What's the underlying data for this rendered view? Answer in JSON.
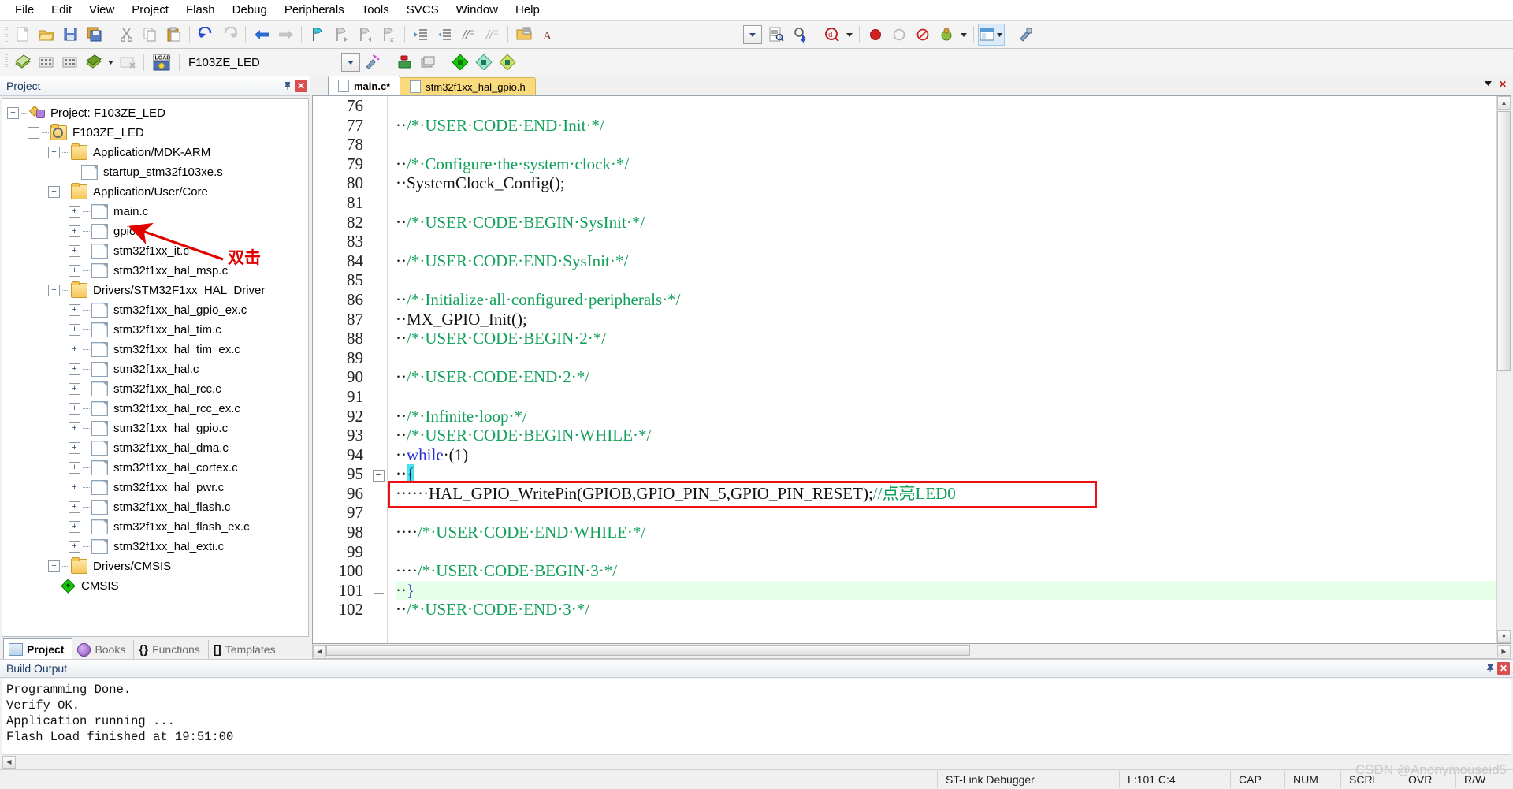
{
  "menu": {
    "items": [
      "File",
      "Edit",
      "View",
      "Project",
      "Flash",
      "Debug",
      "Peripherals",
      "Tools",
      "SVCS",
      "Window",
      "Help"
    ]
  },
  "toolbar1": {
    "icons": [
      "new-file-icon",
      "open-folder-icon",
      "save-icon",
      "save-all-icon",
      "cut-icon",
      "copy-icon",
      "paste-icon",
      "undo-icon",
      "redo-icon",
      "navigate-back-icon",
      "navigate-forward-icon",
      "bookmark-toggle-icon",
      "bookmark-prev-icon",
      "bookmark-next-icon",
      "bookmark-clear-icon",
      "indent-icon",
      "outdent-icon",
      "comment-icon",
      "uncomment-icon",
      "open-in-window-icon",
      "font-icon",
      "find-combo-icon",
      "find-in-files-icon",
      "incremental-find-icon",
      "search-icon",
      "record-icon",
      "stop-icon",
      "break-icon",
      "debug-icon",
      "window-layout-icon",
      "configure-icon"
    ]
  },
  "toolbar2": {
    "project_name": "F103ZE_LED",
    "icons": [
      "translate-icon",
      "build-icon",
      "rebuild-icon",
      "batch-build-icon",
      "stop-build-icon",
      "load-icon",
      "target-combo-icon",
      "target-options-icon",
      "manage-runtime-icon",
      "multiproject-icon",
      "pack-installer-icon",
      "pack-installer2-icon",
      "pack-installer3-icon"
    ],
    "load_label": "LOAD"
  },
  "project_pane": {
    "header_title": "Project",
    "pin_icon": "pin-icon",
    "close_icon": "close-icon",
    "tree": [
      {
        "label": "Project: F103ZE_LED",
        "depth": 0,
        "expander": "minus",
        "icon": "project-icon"
      },
      {
        "label": "F103ZE_LED",
        "depth": 1,
        "expander": "minus",
        "icon": "target-icon"
      },
      {
        "label": "Application/MDK-ARM",
        "depth": 2,
        "expander": "minus",
        "icon": "folder-icon"
      },
      {
        "label": "startup_stm32f103xe.s",
        "depth": 3,
        "expander": "none",
        "icon": "file-icon"
      },
      {
        "label": "Application/User/Core",
        "depth": 2,
        "expander": "minus",
        "icon": "folder-icon"
      },
      {
        "label": "main.c",
        "depth": 3,
        "expander": "plus",
        "icon": "file-icon"
      },
      {
        "label": "gpio.c",
        "depth": 3,
        "expander": "plus",
        "icon": "file-icon"
      },
      {
        "label": "stm32f1xx_it.c",
        "depth": 3,
        "expander": "plus",
        "icon": "file-icon"
      },
      {
        "label": "stm32f1xx_hal_msp.c",
        "depth": 3,
        "expander": "plus",
        "icon": "file-icon"
      },
      {
        "label": "Drivers/STM32F1xx_HAL_Driver",
        "depth": 2,
        "expander": "minus",
        "icon": "folder-icon"
      },
      {
        "label": "stm32f1xx_hal_gpio_ex.c",
        "depth": 3,
        "expander": "plus",
        "icon": "file-icon"
      },
      {
        "label": "stm32f1xx_hal_tim.c",
        "depth": 3,
        "expander": "plus",
        "icon": "file-icon"
      },
      {
        "label": "stm32f1xx_hal_tim_ex.c",
        "depth": 3,
        "expander": "plus",
        "icon": "file-icon"
      },
      {
        "label": "stm32f1xx_hal.c",
        "depth": 3,
        "expander": "plus",
        "icon": "file-icon"
      },
      {
        "label": "stm32f1xx_hal_rcc.c",
        "depth": 3,
        "expander": "plus",
        "icon": "file-icon"
      },
      {
        "label": "stm32f1xx_hal_rcc_ex.c",
        "depth": 3,
        "expander": "plus",
        "icon": "file-icon"
      },
      {
        "label": "stm32f1xx_hal_gpio.c",
        "depth": 3,
        "expander": "plus",
        "icon": "file-icon"
      },
      {
        "label": "stm32f1xx_hal_dma.c",
        "depth": 3,
        "expander": "plus",
        "icon": "file-icon"
      },
      {
        "label": "stm32f1xx_hal_cortex.c",
        "depth": 3,
        "expander": "plus",
        "icon": "file-icon"
      },
      {
        "label": "stm32f1xx_hal_pwr.c",
        "depth": 3,
        "expander": "plus",
        "icon": "file-icon"
      },
      {
        "label": "stm32f1xx_hal_flash.c",
        "depth": 3,
        "expander": "plus",
        "icon": "file-icon"
      },
      {
        "label": "stm32f1xx_hal_flash_ex.c",
        "depth": 3,
        "expander": "plus",
        "icon": "file-icon"
      },
      {
        "label": "stm32f1xx_hal_exti.c",
        "depth": 3,
        "expander": "plus",
        "icon": "file-icon"
      },
      {
        "label": "Drivers/CMSIS",
        "depth": 2,
        "expander": "plus",
        "icon": "folder-icon"
      },
      {
        "label": "CMSIS",
        "depth": 2,
        "expander": "none",
        "icon": "cmsis-icon"
      }
    ],
    "annotation": {
      "text": "双击",
      "color": "#e00000",
      "arrow_icon": "red-arrow-icon"
    },
    "tabs": [
      {
        "label": "Project",
        "icon": "project-tab-icon",
        "active": true
      },
      {
        "label": "Books",
        "icon": "books-icon",
        "active": false
      },
      {
        "label": "Functions",
        "icon": "functions-icon",
        "active": false
      },
      {
        "label": "Templates",
        "icon": "templates-icon",
        "active": false
      }
    ]
  },
  "editor": {
    "tabs": [
      {
        "label": "main.c*",
        "active": true
      },
      {
        "label": "stm32f1xx_hal_gpio.h",
        "active": false
      }
    ],
    "window_buttons": [
      "minimize-icon",
      "close-icon"
    ],
    "first_line_number": 76,
    "lines": [
      {
        "n": 76,
        "segments": [],
        "fold": "",
        "highlight": false
      },
      {
        "n": 77,
        "segments": [
          {
            "t": "··",
            "c": "plain"
          },
          {
            "t": "/*·USER·CODE·END·Init·*/",
            "c": "comment"
          }
        ],
        "fold": "",
        "highlight": false
      },
      {
        "n": 78,
        "segments": [],
        "fold": "",
        "highlight": false
      },
      {
        "n": 79,
        "segments": [
          {
            "t": "··",
            "c": "plain"
          },
          {
            "t": "/*·Configure·the·system·clock·*/",
            "c": "comment"
          }
        ],
        "fold": "",
        "highlight": false
      },
      {
        "n": 80,
        "segments": [
          {
            "t": "··SystemClock_Config();",
            "c": "plain"
          }
        ],
        "fold": "",
        "highlight": false
      },
      {
        "n": 81,
        "segments": [],
        "fold": "",
        "highlight": false
      },
      {
        "n": 82,
        "segments": [
          {
            "t": "··",
            "c": "plain"
          },
          {
            "t": "/*·USER·CODE·BEGIN·SysInit·*/",
            "c": "comment"
          }
        ],
        "fold": "",
        "highlight": false
      },
      {
        "n": 83,
        "segments": [],
        "fold": "",
        "highlight": false
      },
      {
        "n": 84,
        "segments": [
          {
            "t": "··",
            "c": "plain"
          },
          {
            "t": "/*·USER·CODE·END·SysInit·*/",
            "c": "comment"
          }
        ],
        "fold": "",
        "highlight": false
      },
      {
        "n": 85,
        "segments": [],
        "fold": "",
        "highlight": false
      },
      {
        "n": 86,
        "segments": [
          {
            "t": "··",
            "c": "plain"
          },
          {
            "t": "/*·Initialize·all·configured·peripherals·*/",
            "c": "comment"
          }
        ],
        "fold": "",
        "highlight": false
      },
      {
        "n": 87,
        "segments": [
          {
            "t": "··MX_GPIO_Init();",
            "c": "plain"
          }
        ],
        "fold": "",
        "highlight": false
      },
      {
        "n": 88,
        "segments": [
          {
            "t": "··",
            "c": "plain"
          },
          {
            "t": "/*·USER·CODE·BEGIN·2·*/",
            "c": "comment"
          }
        ],
        "fold": "",
        "highlight": false
      },
      {
        "n": 89,
        "segments": [],
        "fold": "",
        "highlight": false
      },
      {
        "n": 90,
        "segments": [
          {
            "t": "··",
            "c": "plain"
          },
          {
            "t": "/*·USER·CODE·END·2·*/",
            "c": "comment"
          }
        ],
        "fold": "",
        "highlight": false
      },
      {
        "n": 91,
        "segments": [],
        "fold": "",
        "highlight": false
      },
      {
        "n": 92,
        "segments": [
          {
            "t": "··",
            "c": "plain"
          },
          {
            "t": "/*·Infinite·loop·*/",
            "c": "comment"
          }
        ],
        "fold": "",
        "highlight": false
      },
      {
        "n": 93,
        "segments": [
          {
            "t": "··",
            "c": "plain"
          },
          {
            "t": "/*·USER·CODE·BEGIN·WHILE·*/",
            "c": "comment"
          }
        ],
        "fold": "",
        "highlight": false
      },
      {
        "n": 94,
        "segments": [
          {
            "t": "··",
            "c": "plain"
          },
          {
            "t": "while",
            "c": "keyword"
          },
          {
            "t": "·(1)",
            "c": "plain"
          }
        ],
        "fold": "",
        "highlight": false
      },
      {
        "n": 95,
        "segments": [
          {
            "t": "··",
            "c": "plain"
          },
          {
            "t": "{",
            "c": "brace-match"
          }
        ],
        "fold": "minus",
        "highlight": false
      },
      {
        "n": 96,
        "segments": [
          {
            "t": "······HAL_GPIO_WritePin(GPIOB,GPIO_PIN_5,GPIO_PIN_RESET);",
            "c": "plain"
          },
          {
            "t": "//点亮LED0",
            "c": "comment"
          }
        ],
        "fold": "",
        "highlight": false
      },
      {
        "n": 97,
        "segments": [],
        "fold": "",
        "highlight": false
      },
      {
        "n": 98,
        "segments": [
          {
            "t": "····",
            "c": "plain"
          },
          {
            "t": "/*·USER·CODE·END·WHILE·*/",
            "c": "comment"
          }
        ],
        "fold": "",
        "highlight": false
      },
      {
        "n": 99,
        "segments": [],
        "fold": "",
        "highlight": false
      },
      {
        "n": 100,
        "segments": [
          {
            "t": "····",
            "c": "plain"
          },
          {
            "t": "/*·USER·CODE·BEGIN·3·*/",
            "c": "comment"
          }
        ],
        "fold": "",
        "highlight": false
      },
      {
        "n": 101,
        "segments": [
          {
            "t": "··",
            "c": "plain"
          },
          {
            "t": "}",
            "c": "keyword"
          }
        ],
        "fold": "dash",
        "highlight": true
      },
      {
        "n": 102,
        "segments": [
          {
            "t": "··",
            "c": "plain"
          },
          {
            "t": "/*·USER·CODE·END·3·*/",
            "c": "comment"
          }
        ],
        "fold": "",
        "highlight": false
      }
    ],
    "highlight_box": {
      "line_start": 96,
      "line_end": 96,
      "color": "#ee1111"
    },
    "scroll": {
      "v_up": "▲",
      "v_down": "▼",
      "h_left": "◀",
      "h_right": "▶"
    }
  },
  "build_output": {
    "header_title": "Build Output",
    "pin_icon": "pin-icon",
    "close_icon": "close-icon",
    "lines": [
      "Programming Done.",
      "Verify OK.",
      "Application running ...",
      "Flash Load finished at 19:51:00"
    ]
  },
  "status_bar": {
    "debugger": "ST-Link Debugger",
    "cursor": "L:101 C:4",
    "caps": "CAP",
    "num": "NUM",
    "scrl": "SCRL",
    "ovr": "OVR",
    "rw": "R/W"
  },
  "watermark": "CSDN @Anonymouseid5"
}
